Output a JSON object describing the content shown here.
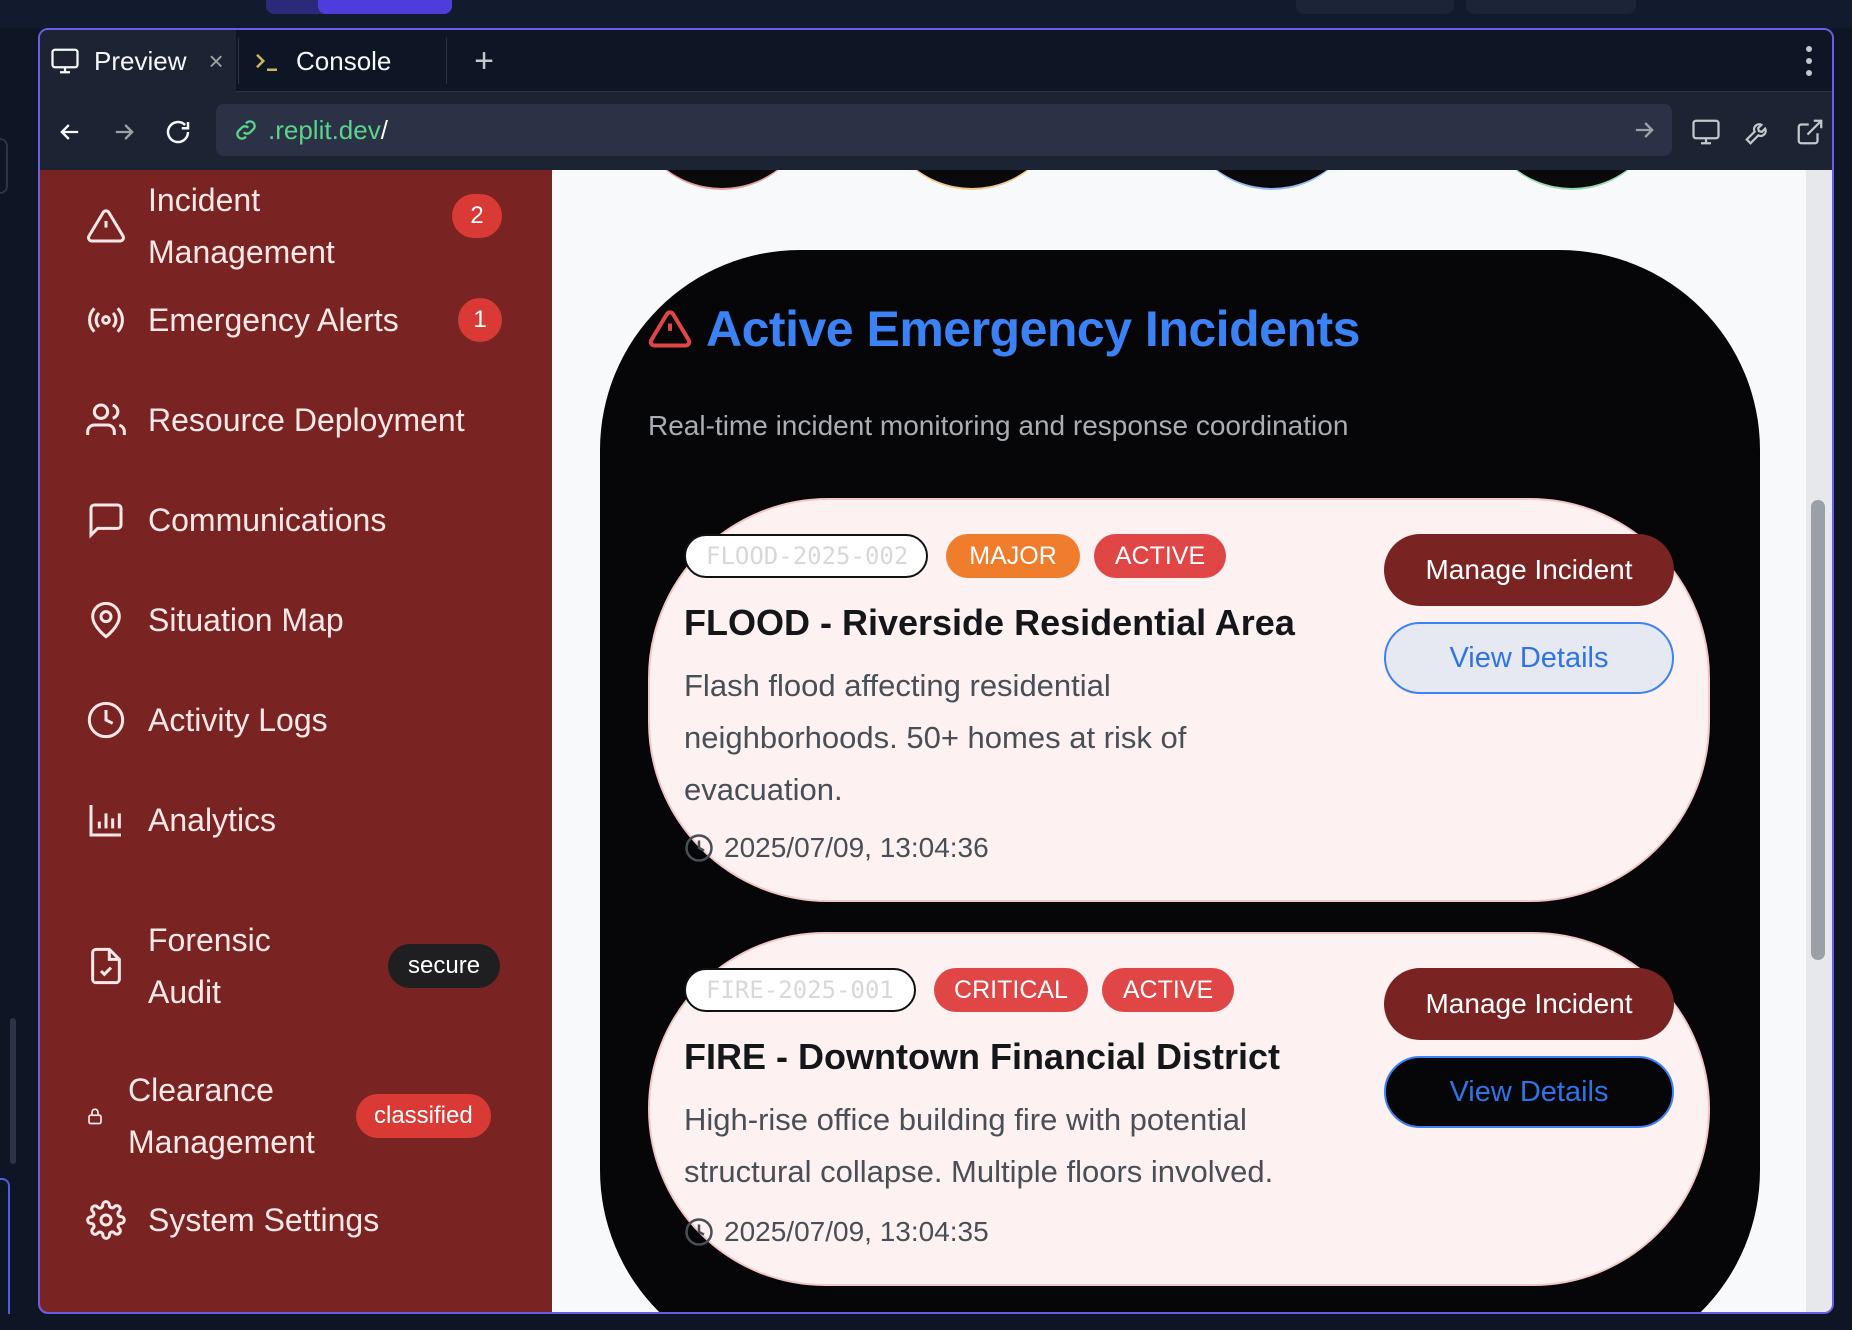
{
  "browser": {
    "tabs": [
      {
        "label": "Preview",
        "active": true,
        "icon": "monitor-icon"
      },
      {
        "label": "Console",
        "active": false,
        "icon": "terminal-icon"
      }
    ],
    "new_tab_symbol": "+",
    "close_symbol": "×",
    "url": {
      "host": ".replit.dev",
      "path": "/"
    }
  },
  "sidebar": {
    "items": [
      {
        "label_line1": "Incident",
        "label_line2": "Management",
        "icon": "alert-triangle-icon",
        "badge": "2"
      },
      {
        "label": "Emergency Alerts",
        "icon": "radio-broadcast-icon",
        "badge": "1"
      },
      {
        "label": "Resource Deployment",
        "icon": "users-icon"
      },
      {
        "label": "Communications",
        "icon": "message-square-icon"
      },
      {
        "label": "Situation Map",
        "icon": "map-pin-icon"
      },
      {
        "label": "Activity Logs",
        "icon": "clock-icon"
      },
      {
        "label": "Analytics",
        "icon": "bar-chart-icon"
      },
      {
        "label_line1": "Forensic",
        "label_line2": "Audit",
        "icon": "file-check-icon",
        "badge": "secure"
      },
      {
        "label_line1": "Clearance",
        "label_line2": "Management",
        "icon": "lock-icon",
        "badge": "classified"
      },
      {
        "label": "System Settings",
        "icon": "gear-icon"
      }
    ]
  },
  "incidents_panel": {
    "title": "Active Emergency Incidents",
    "subtitle": "Real-time incident monitoring and response coordination",
    "incidents": [
      {
        "id": "FLOOD-2025-002",
        "severity": "MAJOR",
        "status": "ACTIVE",
        "title": "FLOOD - Riverside Residential Area",
        "description_lines": [
          "Flash flood affecting residential",
          "neighborhoods. 50+ homes at risk of",
          "evacuation."
        ],
        "timestamp": "2025/07/09, 13:04:36",
        "manage_label": "Manage Incident",
        "view_label": "View Details"
      },
      {
        "id": "FIRE-2025-001",
        "severity": "CRITICAL",
        "status": "ACTIVE",
        "title": "FIRE - Downtown Financial District",
        "description_lines": [
          "High-rise office building fire with potential",
          "structural collapse. Multiple floors involved."
        ],
        "timestamp": "2025/07/09, 13:04:35",
        "manage_label": "Manage Incident",
        "view_label": "View Details"
      }
    ]
  },
  "colors": {
    "sidebar_bg": "#7a2323",
    "accent_blue": "#3b82f6",
    "badge_red": "#d93a36",
    "major_orange": "#ef7d2c",
    "pane_border": "#6c5ce7"
  }
}
